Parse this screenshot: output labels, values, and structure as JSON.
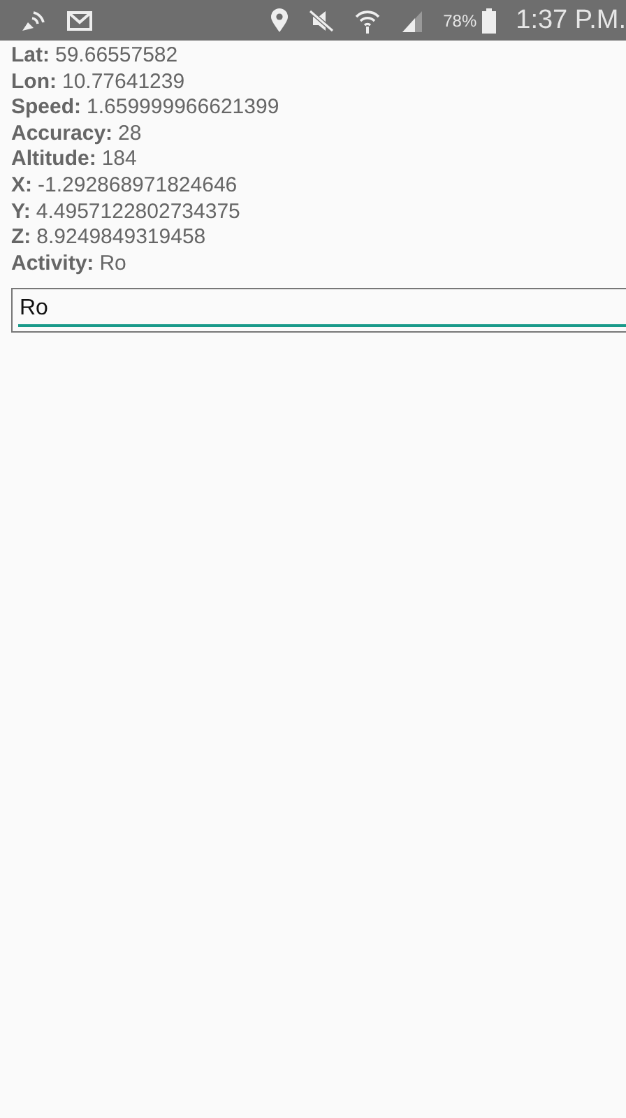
{
  "status_bar": {
    "battery": "78%",
    "time": "1:37 P.M."
  },
  "readings": [
    {
      "label": "Lat:",
      "value": "59.66557582"
    },
    {
      "label": "Lon:",
      "value": "10.77641239"
    },
    {
      "label": "Speed:",
      "value": "1.659999966621399"
    },
    {
      "label": "Accuracy:",
      "value": "28"
    },
    {
      "label": "Altitude:",
      "value": "184"
    },
    {
      "label": "X:",
      "value": "-1.292868971824646"
    },
    {
      "label": "Y:",
      "value": "4.4957122802734375"
    },
    {
      "label": "Z:",
      "value": "8.9249849319458"
    },
    {
      "label": "Activity:",
      "value": "Ro"
    }
  ],
  "activity_field": {
    "value": "Ro"
  }
}
